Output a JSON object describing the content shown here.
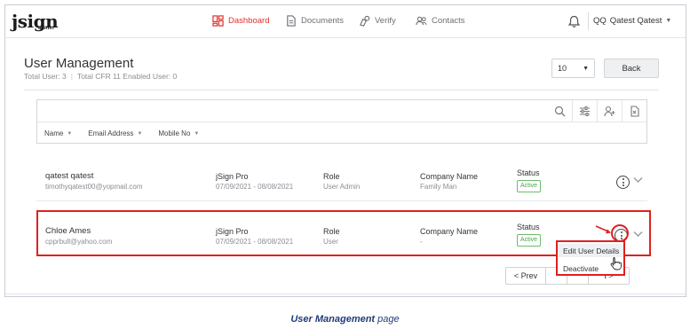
{
  "nav": {
    "logo": "jsign",
    "logo_sub": "admin",
    "items": [
      {
        "label": "Dashboard",
        "icon": "dashboard-icon",
        "active": true
      },
      {
        "label": "Documents",
        "icon": "documents-icon",
        "active": false
      },
      {
        "label": "Verify",
        "icon": "verify-icon",
        "active": false
      },
      {
        "label": "Contacts",
        "icon": "contacts-icon",
        "active": false
      }
    ],
    "user_initials": "QQ",
    "user_name": "Qatest Qatest"
  },
  "page": {
    "title": "User Management",
    "total_users": "Total User: 3",
    "total_cfr": "Total CFR 11 Enabled User: 0",
    "page_size": "10",
    "back_label": "Back"
  },
  "filters": {
    "columns": [
      "Name",
      "Email Address",
      "Mobile No"
    ]
  },
  "users": [
    {
      "name": "qatest qatest",
      "email": "timothyqatest00@yopmail.com",
      "plan": "jSign Pro",
      "period": "07/09/2021 - 08/08/2021",
      "role_label": "Role",
      "role": "User Admin",
      "company_label": "Company Name",
      "company": "Family Man",
      "status_label": "Status",
      "status": "Active"
    },
    {
      "name": "Chloe Ames",
      "email": "cpprbull@yahoo.com",
      "plan": "jSign Pro",
      "period": "07/09/2021 - 08/08/2021",
      "role_label": "Role",
      "role": "User",
      "company_label": "Company Name",
      "company": "-",
      "status_label": "Status",
      "status": "Active"
    }
  ],
  "menu": {
    "edit": "Edit User Details",
    "deactivate": "Deactivate"
  },
  "pager": {
    "prev": "< Prev",
    "next": "t >"
  },
  "caption": {
    "bold": "User Management",
    "rest": " page"
  },
  "colors": {
    "accent": "#e0322a",
    "highlight": "#e02020",
    "active_badge": "#4aa54a",
    "caption": "#1f3d7a"
  }
}
